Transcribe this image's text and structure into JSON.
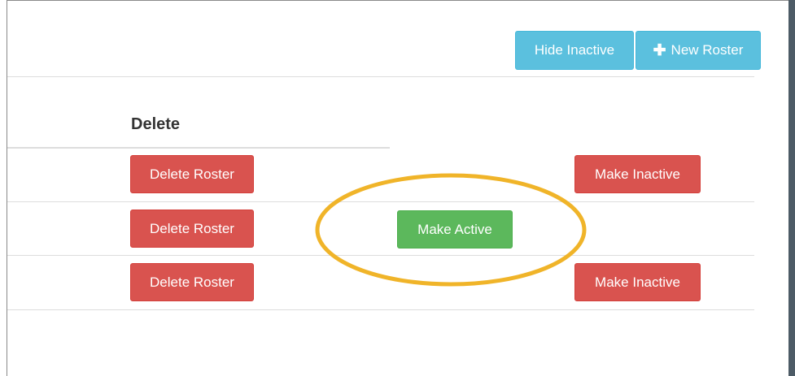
{
  "toolbar": {
    "hide_inactive_label": "Hide Inactive",
    "new_roster_label": "New Roster",
    "new_roster_icon": "plus-icon"
  },
  "table": {
    "column_header": "Delete",
    "rows": [
      {
        "delete_label": "Delete Roster",
        "status_action_label": "Make Inactive"
      },
      {
        "delete_label": "Delete Roster",
        "status_action_label": "Make Active"
      },
      {
        "delete_label": "Delete Roster",
        "status_action_label": "Make Inactive"
      }
    ]
  },
  "colors": {
    "info": "#5bc0de",
    "danger": "#d9534f",
    "success": "#5cb85c",
    "annotation": "#f0b429"
  }
}
